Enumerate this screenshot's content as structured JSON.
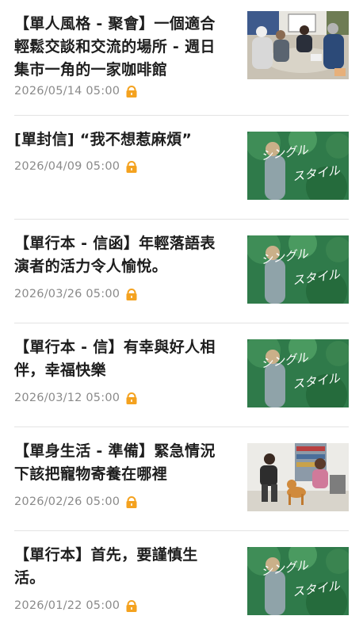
{
  "articles": [
    {
      "title": "【單人風格 - 聚會】一個適合輕鬆交談和交流的場所 - 週日集市一角的一家咖啡館",
      "date": "2026/05/14 05:00",
      "thumbnail": "cafe-meeting-photo"
    },
    {
      "title": "[單封信] “我不想惹麻煩”",
      "date": "2026/04/09 05:00",
      "thumbnail": "single-style-banner"
    },
    {
      "title": "【單行本 - 信函】年輕落語表演者的活力令人愉悅。",
      "date": "2026/03/26 05:00",
      "thumbnail": "single-style-banner"
    },
    {
      "title": "【單行本 - 信】有幸與好人相伴，幸福快樂",
      "date": "2026/03/12 05:00",
      "thumbnail": "single-style-banner"
    },
    {
      "title": "【單身生活 - 準備】緊急情況下該把寵物寄養在哪裡",
      "date": "2026/02/26 05:00",
      "thumbnail": "people-with-dog-photo"
    },
    {
      "title": "【單行本】首先，要謹慎生活。",
      "date": "2026/01/22 05:00",
      "thumbnail": "single-style-banner"
    }
  ],
  "banner_text": {
    "line1": "シングル",
    "line2": "スタイル"
  },
  "colors": {
    "lock": "#f4a21f",
    "meta": "#8a8a8a",
    "divider": "#e3e3e3",
    "banner_green": "#2f7a4a"
  }
}
